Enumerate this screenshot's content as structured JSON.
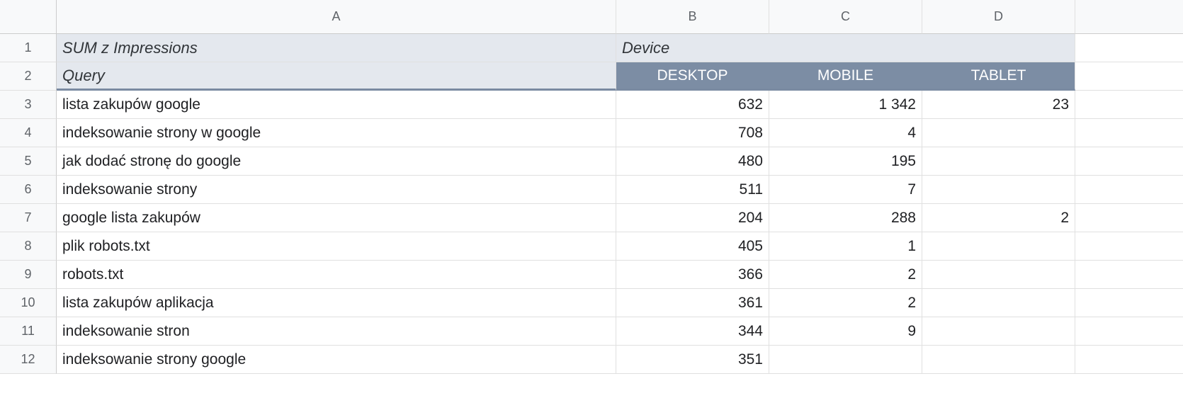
{
  "columns": [
    "A",
    "B",
    "C",
    "D"
  ],
  "row_numbers": [
    "1",
    "2",
    "3",
    "4",
    "5",
    "6",
    "7",
    "8",
    "9",
    "10",
    "11",
    "12"
  ],
  "header1": {
    "a": "SUM z Impressions",
    "b": "Device"
  },
  "header2": {
    "a": "Query",
    "b": "DESKTOP",
    "c": "MOBILE",
    "d": "TABLET"
  },
  "rows": [
    {
      "query": "lista zakupów google",
      "desktop": "632",
      "mobile": "1 342",
      "tablet": "23"
    },
    {
      "query": "indeksowanie strony w google",
      "desktop": "708",
      "mobile": "4",
      "tablet": ""
    },
    {
      "query": "jak dodać stronę do google",
      "desktop": "480",
      "mobile": "195",
      "tablet": ""
    },
    {
      "query": "indeksowanie strony",
      "desktop": "511",
      "mobile": "7",
      "tablet": ""
    },
    {
      "query": "google lista zakupów",
      "desktop": "204",
      "mobile": "288",
      "tablet": "2"
    },
    {
      "query": "plik robots.txt",
      "desktop": "405",
      "mobile": "1",
      "tablet": ""
    },
    {
      "query": "robots.txt",
      "desktop": "366",
      "mobile": "2",
      "tablet": ""
    },
    {
      "query": "lista zakupów aplikacja",
      "desktop": "361",
      "mobile": "2",
      "tablet": ""
    },
    {
      "query": "indeksowanie stron",
      "desktop": "344",
      "mobile": "9",
      "tablet": ""
    },
    {
      "query": "indeksowanie strony google",
      "desktop": "351",
      "mobile": "",
      "tablet": ""
    }
  ]
}
